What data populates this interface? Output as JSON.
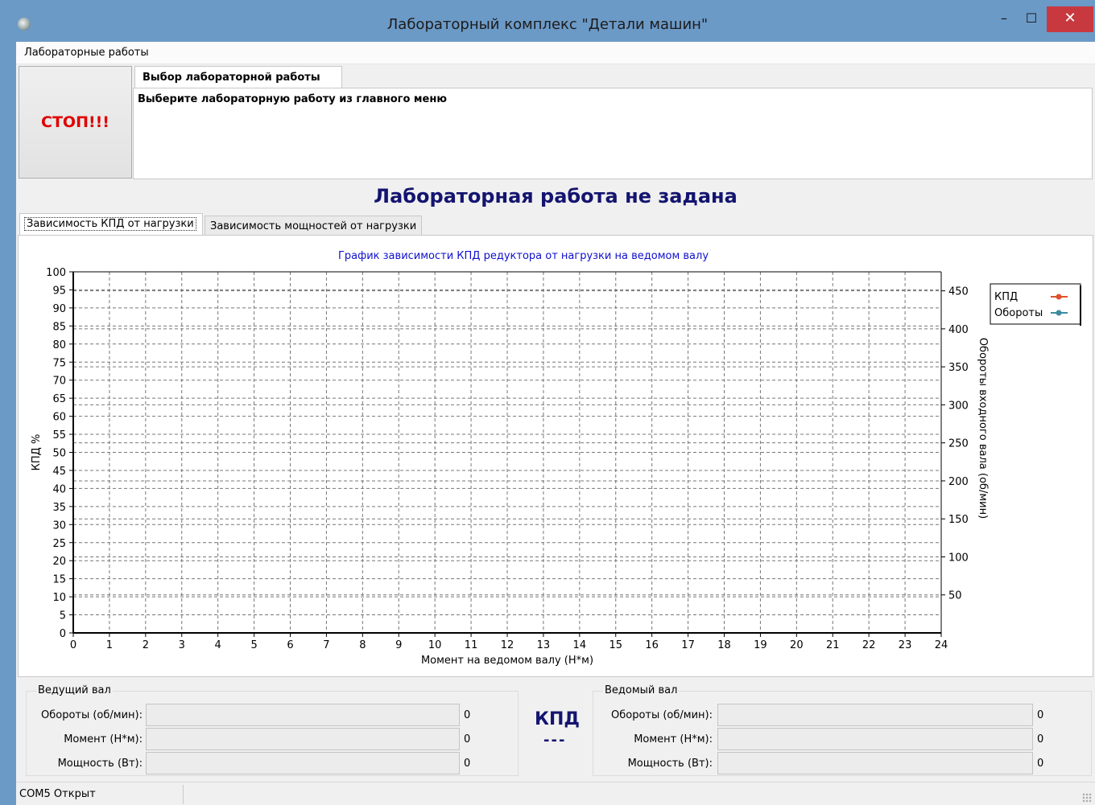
{
  "window": {
    "title": "Лабораторный комплекс \"Детали машин\"",
    "min_glyph": "–",
    "max_glyph": "☐",
    "close_glyph": "✕"
  },
  "menu": {
    "items": [
      "Лабораторные работы"
    ]
  },
  "stop_button": {
    "label": "СТОП!!!"
  },
  "lab_tab": {
    "label": "Выбор лабораторной работы",
    "message": "Выберите лабораторную работу из главного меню"
  },
  "heading": "Лабораторная работа не задана",
  "chart_tabs": [
    "Зависимость КПД от нагрузки",
    "Зависимость мощностей от нагрузки"
  ],
  "chart_data": {
    "type": "line",
    "title": "График зависимости КПД редуктора от нагрузки на ведомом валу",
    "xlabel": "Момент на ведомом валу (Н*м)",
    "ylabel": "КПД %",
    "y2label": "Обороты входного вала (об/мин)",
    "xlim": [
      0,
      24
    ],
    "ylim": [
      0,
      100
    ],
    "y2_ticks": [
      50,
      100,
      150,
      200,
      250,
      300,
      350,
      400,
      450
    ],
    "grid": true,
    "legend_position": "top-right",
    "series": [
      {
        "name": "КПД",
        "color": "#e0502a",
        "x": [],
        "y": []
      },
      {
        "name": "Обороты",
        "color": "#3c8ca0",
        "x": [],
        "y": []
      }
    ]
  },
  "drive_shaft": {
    "title": "Ведущий вал",
    "rows": [
      {
        "label": "Обороты (об/мин):",
        "value": "0"
      },
      {
        "label": "Момент (Н*м):",
        "value": "0"
      },
      {
        "label": "Мощность (Вт):",
        "value": "0"
      }
    ]
  },
  "kpd": {
    "label": "КПД",
    "value": "---"
  },
  "driven_shaft": {
    "title": "Ведомый вал",
    "rows": [
      {
        "label": "Обороты (об/мин):",
        "value": "0"
      },
      {
        "label": "Момент (Н*м):",
        "value": "0"
      },
      {
        "label": "Мощность (Вт):",
        "value": "0"
      }
    ]
  },
  "status": {
    "text": "COM5 Открыт"
  }
}
